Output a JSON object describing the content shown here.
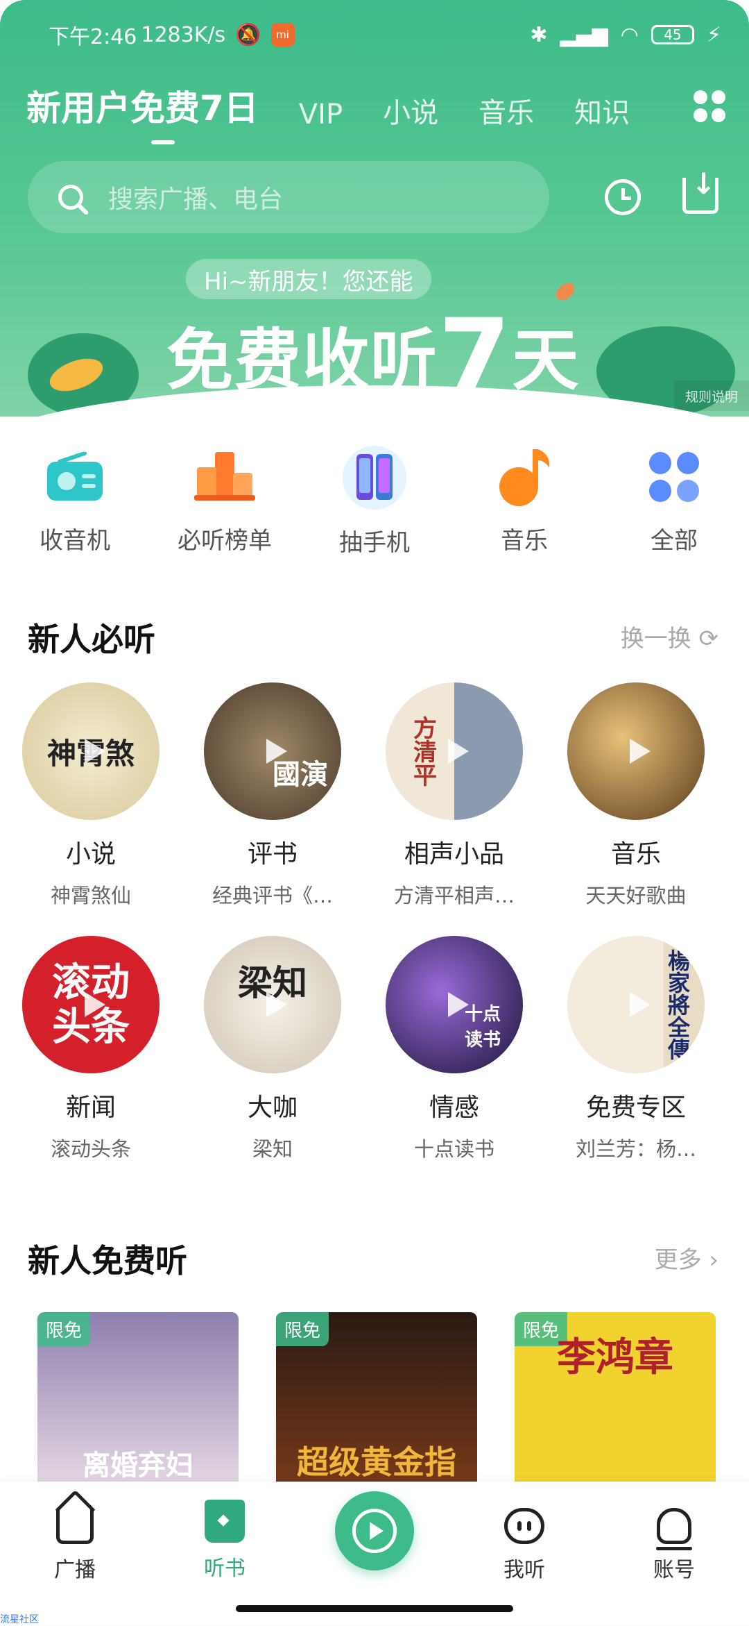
{
  "status_bar": {
    "time": "下午2:46",
    "speed": "1283K/s",
    "battery": "45",
    "miui_label": "mi"
  },
  "header": {
    "tabs": [
      {
        "label": "新用户免费7日",
        "active": true
      },
      {
        "label": "VIP"
      },
      {
        "label": "小说"
      },
      {
        "label": "音乐"
      },
      {
        "label": "知识"
      }
    ],
    "search_placeholder": "搜索广播、电台"
  },
  "banner": {
    "greeting": "Hi~新朋友！您还能",
    "main_prefix": "免费收听",
    "main_number": "7",
    "main_suffix": "天",
    "rules": "规则说明"
  },
  "categories": [
    {
      "label": "收音机",
      "icon": "radio-icon"
    },
    {
      "label": "必听榜单",
      "icon": "chart-icon"
    },
    {
      "label": "抽手机",
      "icon": "phone-icon"
    },
    {
      "label": "音乐",
      "icon": "music-note-icon"
    },
    {
      "label": "全部",
      "icon": "grid-icon"
    }
  ],
  "section_must_listen": {
    "title": "新人必听",
    "action": "换一换"
  },
  "albums_row1": [
    {
      "title": "小说",
      "subtitle": "神霄煞仙",
      "cover_text": "神霄煞"
    },
    {
      "title": "评书",
      "subtitle": "经典评书《…",
      "cover_text": "國演"
    },
    {
      "title": "相声小品",
      "subtitle": "方清平相声…",
      "cover_text": "方清平"
    },
    {
      "title": "音乐",
      "subtitle": "天天好歌曲",
      "cover_text": ""
    }
  ],
  "albums_row2": [
    {
      "title": "新闻",
      "subtitle": "滚动头条",
      "cover_text": "滚动头条"
    },
    {
      "title": "大咖",
      "subtitle": "梁知",
      "cover_text": "梁知"
    },
    {
      "title": "情感",
      "subtitle": "十点读书",
      "cover_text": "十点读书"
    },
    {
      "title": "免费专区",
      "subtitle": "刘兰芳：杨…",
      "cover_text": "楊家將全傳"
    }
  ],
  "section_free": {
    "title": "新人免费听",
    "action": "更多"
  },
  "free_books": [
    {
      "badge": "限免",
      "cover_text": "离婚弃妇",
      "color": "#b8a9c9"
    },
    {
      "badge": "限免",
      "cover_text": "超级黄金指",
      "color": "#5a3a2a"
    },
    {
      "badge": "限免",
      "cover_text": "李鸿章",
      "color": "#f2d22e"
    }
  ],
  "bottom_nav": [
    {
      "label": "广播",
      "icon": "home-icon"
    },
    {
      "label": "听书",
      "icon": "book-icon",
      "active": true
    },
    {
      "label": "",
      "icon": "play-center-icon"
    },
    {
      "label": "我听",
      "icon": "robot-icon"
    },
    {
      "label": "账号",
      "icon": "account-icon"
    }
  ],
  "corner_tag": "流星社区",
  "colors": {
    "brand": "#3dbb8a",
    "brand_dark": "#2fa97d"
  }
}
